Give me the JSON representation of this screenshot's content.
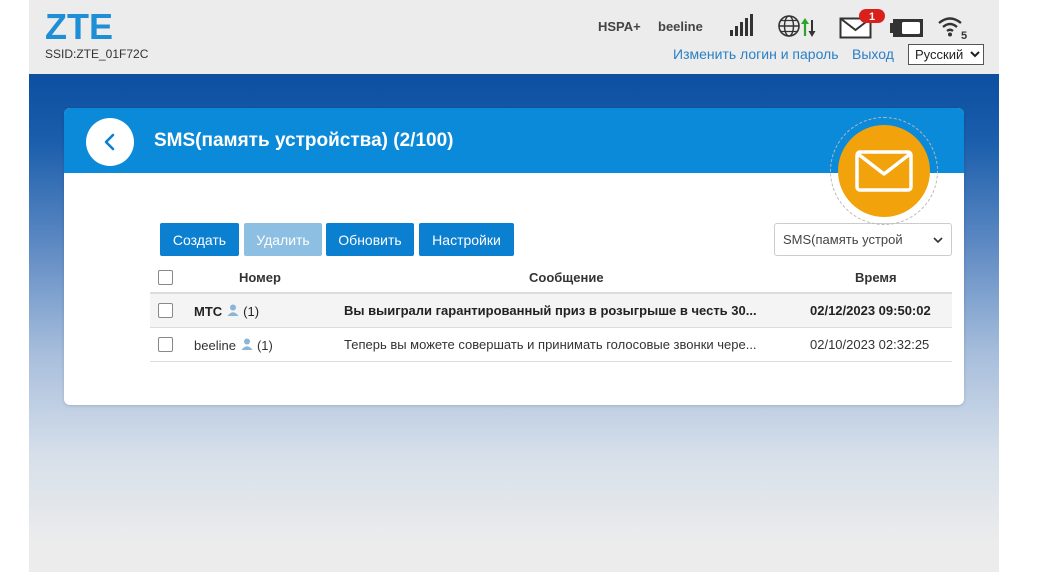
{
  "header": {
    "logo": "ZTE",
    "ssid": "SSID:ZTE_01F72C",
    "network_type": "HSPA+",
    "operator": "beeline",
    "unread_count": "1",
    "wifi_clients": "5",
    "change_login_link": "Изменить логин и пароль",
    "logout_link": "Выход",
    "language": "Русский"
  },
  "sms": {
    "title": "SMS(память устройства) (2/100)",
    "toolbar": {
      "create": "Создать",
      "delete": "Удалить",
      "refresh": "Обновить",
      "settings": "Настройки"
    },
    "storage_selected": "SMS(память устрой",
    "columns": {
      "number": "Номер",
      "message": "Сообщение",
      "time": "Время"
    },
    "rows": [
      {
        "number": "МТС",
        "count": "(1)",
        "message": "Вы выиграли гарантированный приз в розыгрыше в честь 30...",
        "time": "02/12/2023 09:50:02",
        "unread": true
      },
      {
        "number": "beeline",
        "count": "(1)",
        "message": "Теперь вы можете совершать и принимать голосовые звонки чере...",
        "time": "02/10/2023 02:32:25",
        "unread": false
      }
    ]
  },
  "colors": {
    "brand_blue": "#1e8fd6",
    "header_blue": "#0b8ad9",
    "button_blue": "#0b7fd0",
    "badge_red": "#d9211b",
    "envelope_orange": "#f2a20a"
  },
  "icons": [
    "signal-icon",
    "globe-icon",
    "mail-icon",
    "battery-icon",
    "wifi-icon",
    "back-arrow-icon",
    "envelope-icon",
    "person-icon"
  ]
}
